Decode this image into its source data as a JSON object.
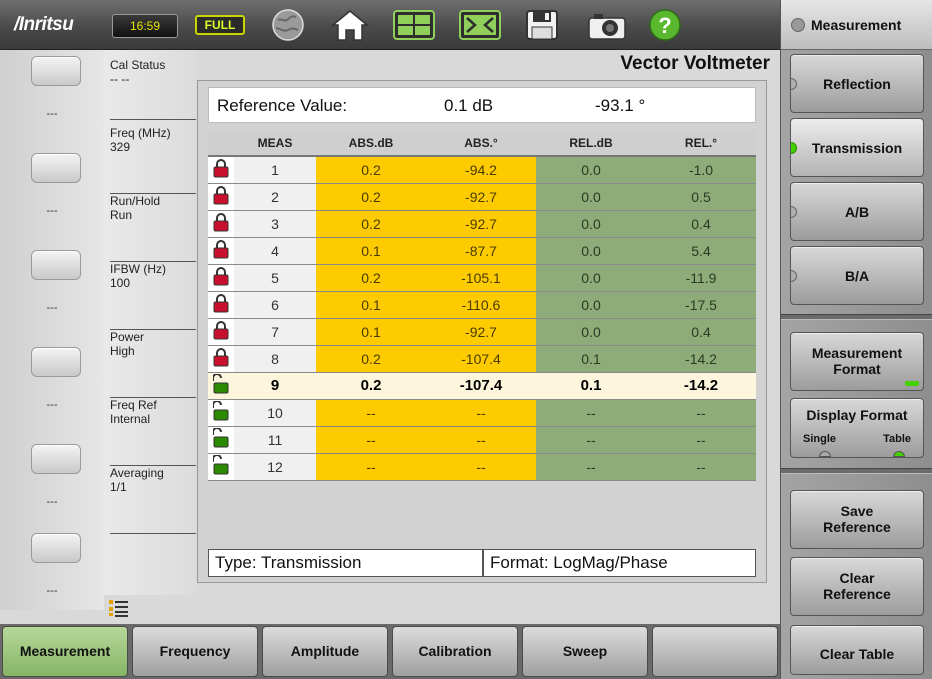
{
  "topbar": {
    "logo": "/Inritsu",
    "clock": "16:59",
    "battery": "FULL",
    "icons": [
      "globe-icon",
      "home-icon",
      "split-screen-icon",
      "fullscreen-icon",
      "save-icon",
      "camera-icon",
      "help-icon"
    ]
  },
  "left_keys": [
    "---",
    "---",
    "---",
    "---",
    "---",
    "---"
  ],
  "status_panel": [
    {
      "label": "Cal Status",
      "value": "-- --"
    },
    {
      "label": "Freq (MHz)",
      "value": "329"
    },
    {
      "label": "Run/Hold",
      "value": "Run"
    },
    {
      "label": "IFBW (Hz)",
      "value": "100"
    },
    {
      "label": "Power",
      "value": "High"
    },
    {
      "label": "Freq Ref",
      "value": "Internal"
    },
    {
      "label": "Averaging",
      "value": "1/1"
    }
  ],
  "main": {
    "title": "Vector Voltmeter",
    "reference": {
      "label": "Reference Value:",
      "db": "0.1 dB",
      "deg": "-93.1 °"
    },
    "table": {
      "headers": [
        "MEAS",
        "ABS.dB",
        "ABS.°",
        "REL.dB",
        "REL.°"
      ],
      "selected_row": 9,
      "rows": [
        {
          "meas": "1",
          "abs_db": "0.2",
          "abs_deg": "-94.2",
          "rel_db": "0.0",
          "rel_deg": "-1.0",
          "locked": true
        },
        {
          "meas": "2",
          "abs_db": "0.2",
          "abs_deg": "-92.7",
          "rel_db": "0.0",
          "rel_deg": "0.5",
          "locked": true
        },
        {
          "meas": "3",
          "abs_db": "0.2",
          "abs_deg": "-92.7",
          "rel_db": "0.0",
          "rel_deg": "0.4",
          "locked": true
        },
        {
          "meas": "4",
          "abs_db": "0.1",
          "abs_deg": "-87.7",
          "rel_db": "0.0",
          "rel_deg": "5.4",
          "locked": true
        },
        {
          "meas": "5",
          "abs_db": "0.2",
          "abs_deg": "-105.1",
          "rel_db": "0.0",
          "rel_deg": "-11.9",
          "locked": true
        },
        {
          "meas": "6",
          "abs_db": "0.1",
          "abs_deg": "-110.6",
          "rel_db": "0.0",
          "rel_deg": "-17.5",
          "locked": true
        },
        {
          "meas": "7",
          "abs_db": "0.1",
          "abs_deg": "-92.7",
          "rel_db": "0.0",
          "rel_deg": "0.4",
          "locked": true
        },
        {
          "meas": "8",
          "abs_db": "0.2",
          "abs_deg": "-107.4",
          "rel_db": "0.1",
          "rel_deg": "-14.2",
          "locked": true
        },
        {
          "meas": "9",
          "abs_db": "0.2",
          "abs_deg": "-107.4",
          "rel_db": "0.1",
          "rel_deg": "-14.2",
          "locked": false
        },
        {
          "meas": "10",
          "abs_db": "--",
          "abs_deg": "--",
          "rel_db": "--",
          "rel_deg": "--",
          "locked": false
        },
        {
          "meas": "11",
          "abs_db": "--",
          "abs_deg": "--",
          "rel_db": "--",
          "rel_deg": "--",
          "locked": false
        },
        {
          "meas": "12",
          "abs_db": "--",
          "abs_deg": "--",
          "rel_db": "--",
          "rel_deg": "--",
          "locked": false
        }
      ]
    },
    "type_label": "Type: Transmission",
    "format_label": "Format: LogMag/Phase"
  },
  "right_menu": {
    "title": "Measurement",
    "items": [
      {
        "label": "Reflection",
        "selected": false
      },
      {
        "label": "Transmission",
        "selected": true
      },
      {
        "label": "A/B",
        "selected": false
      },
      {
        "label": "B/A",
        "selected": false
      }
    ],
    "measurement_format": "Measurement Format",
    "display_format": {
      "label": "Display Format",
      "option_a": "Single",
      "option_b": "Table",
      "selected": "Table"
    },
    "save_reference": "Save Reference",
    "clear_reference": "Clear Reference",
    "clear_table": "Clear Table"
  },
  "tabs": [
    "Measurement",
    "Frequency",
    "Amplitude",
    "Calibration",
    "Sweep",
    ""
  ],
  "active_tab": "Measurement",
  "colors": {
    "abs": "#fecb00",
    "rel": "#8eac7a",
    "lock_closed": "#c8102e",
    "lock_open": "#2c8a00",
    "selected_row": "#fdf6dc"
  }
}
